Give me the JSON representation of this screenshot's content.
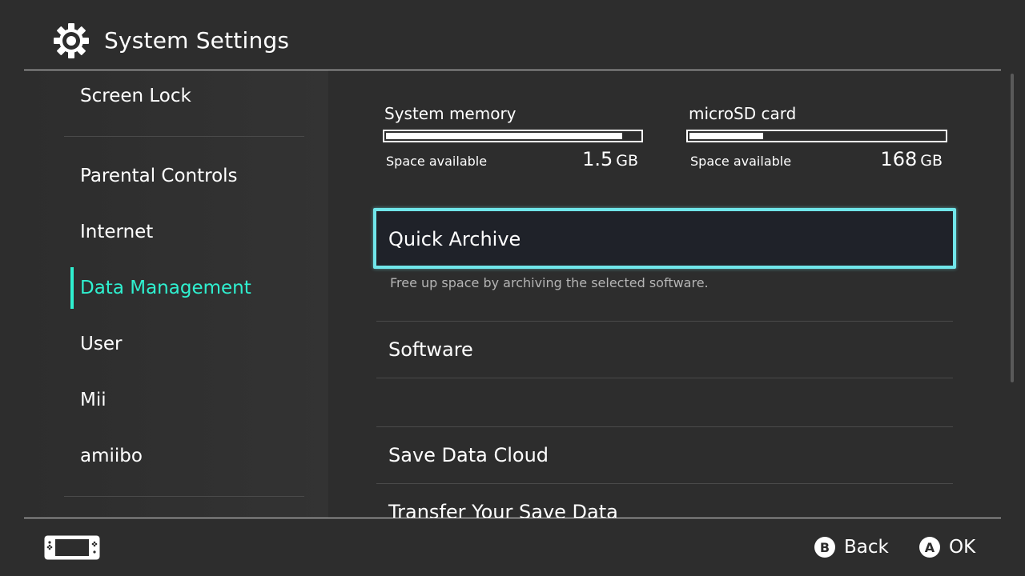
{
  "header": {
    "title": "System Settings",
    "icon": "gear-icon"
  },
  "sidebar": {
    "items": [
      {
        "label": "Screen Lock"
      },
      {
        "label": "Parental Controls"
      },
      {
        "label": "Internet"
      },
      {
        "label": "Data Management",
        "active": true
      },
      {
        "label": "User"
      },
      {
        "label": "Mii"
      },
      {
        "label": "amiibo"
      }
    ]
  },
  "storage": {
    "system": {
      "label": "System memory",
      "used_fraction": 0.93,
      "available_label": "Space available",
      "available_value": "1.5",
      "available_unit": "GB"
    },
    "sd": {
      "label": "microSD card",
      "used_fraction": 0.29,
      "available_label": "Space available",
      "available_value": "168",
      "available_unit": "GB"
    }
  },
  "menu": {
    "quick_archive": "Quick Archive",
    "quick_archive_desc": "Free up space by archiving the selected software.",
    "software": "Software",
    "save_data_cloud": "Save Data Cloud",
    "transfer_save": "Transfer Your Save Data"
  },
  "footer": {
    "back_button_glyph": "B",
    "back_label": "Back",
    "ok_button_glyph": "A",
    "ok_label": "OK",
    "console_icon": "console-icon"
  },
  "colors": {
    "background": "#2d2d2d",
    "accent": "#2ff0d0",
    "focus_border": "#70e6ea"
  }
}
